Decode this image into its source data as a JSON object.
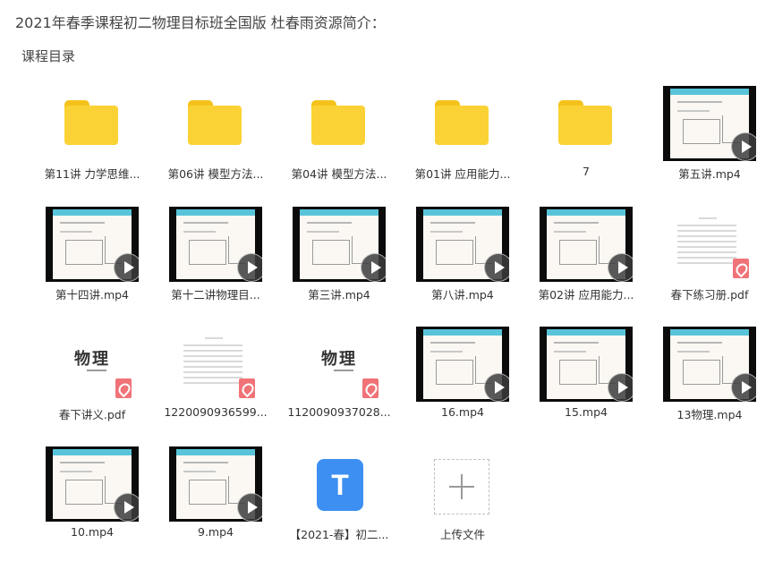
{
  "page": {
    "title": "2021年春季课程初二物理目标班全国版 杜春雨资源简介：",
    "section": "课程目录"
  },
  "items": [
    {
      "name": "第11讲 力学思维...",
      "type": "folder",
      "icon": "folder-icon"
    },
    {
      "name": "第06讲 模型方法...",
      "type": "folder",
      "icon": "folder-icon"
    },
    {
      "name": "第04讲 模型方法...",
      "type": "folder",
      "icon": "folder-icon"
    },
    {
      "name": "第01讲 应用能力...",
      "type": "folder",
      "icon": "folder-icon"
    },
    {
      "name": "7",
      "type": "folder",
      "icon": "folder-icon"
    },
    {
      "name": "第五讲.mp4",
      "type": "video",
      "icon": "play-icon"
    },
    {
      "name": "第十四讲.mp4",
      "type": "video",
      "icon": "play-icon"
    },
    {
      "name": "第十二讲物理目...",
      "type": "video",
      "icon": "play-icon"
    },
    {
      "name": "第三讲.mp4",
      "type": "video",
      "icon": "play-icon"
    },
    {
      "name": "第八讲.mp4",
      "type": "video",
      "icon": "play-icon"
    },
    {
      "name": "第02讲 应用能力...",
      "type": "video",
      "icon": "play-icon"
    },
    {
      "name": "春下练习册.pdf",
      "type": "pdf",
      "icon": "pdf-icon"
    },
    {
      "name": "春下讲义.pdf",
      "type": "pdf",
      "icon": "pdf-icon",
      "cover_text": "物理"
    },
    {
      "name": "1220090936599...",
      "type": "pdf",
      "icon": "pdf-icon"
    },
    {
      "name": "1120090937028...",
      "type": "pdf",
      "icon": "pdf-icon",
      "cover_text": "物理"
    },
    {
      "name": "16.mp4",
      "type": "video",
      "icon": "play-icon"
    },
    {
      "name": "15.mp4",
      "type": "video",
      "icon": "play-icon"
    },
    {
      "name": "13物理.mp4",
      "type": "video",
      "icon": "play-icon"
    },
    {
      "name": "10.mp4",
      "type": "video",
      "icon": "play-icon"
    },
    {
      "name": "9.mp4",
      "type": "video",
      "icon": "play-icon"
    },
    {
      "name": "【2021-春】初二...",
      "type": "doc",
      "icon": "text-document-icon",
      "glyph": "T"
    },
    {
      "name": "上传文件",
      "type": "upload",
      "icon": "plus-icon"
    }
  ],
  "colors": {
    "folder": "#fbd235",
    "folder_tab": "#f4c21b",
    "video_band": "#59c4d9",
    "pdf_badge": "#f07378",
    "doc_icon": "#3d8ff1"
  }
}
